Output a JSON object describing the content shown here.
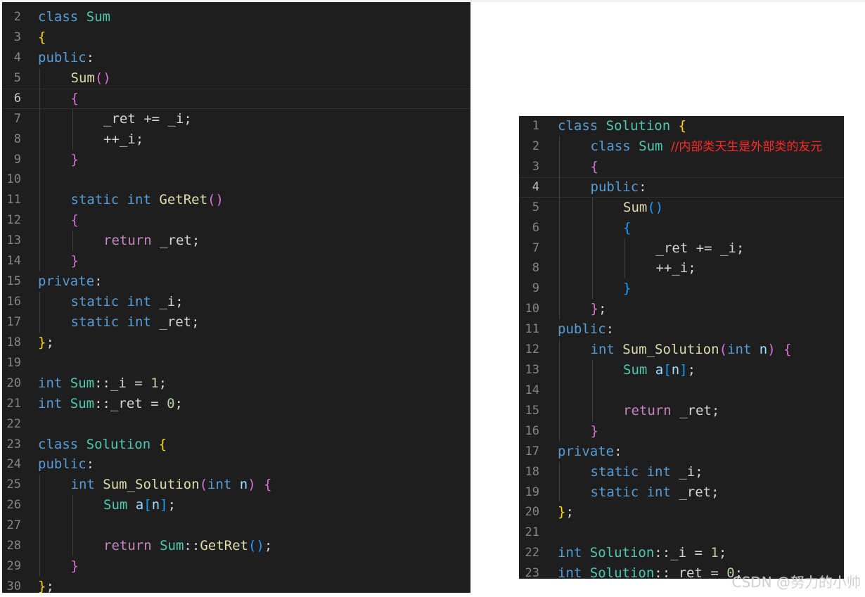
{
  "colors": {
    "editor_bg": "#1e1e1e",
    "keyword": "#569cd6",
    "class_name": "#4ec9b0",
    "function": "#dcdcaa",
    "control": "#c586c0",
    "number": "#b5cea8",
    "bracket_level1": "#ffd700",
    "bracket_level2": "#da70d6",
    "bracket_level3": "#179fff",
    "comment": "#ff2a2a"
  },
  "left_editor": {
    "active_line": "6",
    "lines": [
      {
        "num": "2",
        "indent": 0,
        "tokens": [
          [
            "kw",
            "class"
          ],
          [
            "txt",
            " "
          ],
          [
            "cls",
            "Sum"
          ]
        ]
      },
      {
        "num": "3",
        "indent": 0,
        "tokens": [
          [
            "br1",
            "{"
          ]
        ]
      },
      {
        "num": "4",
        "indent": 0,
        "tokens": [
          [
            "kw",
            "public"
          ],
          [
            "txt",
            ":"
          ]
        ]
      },
      {
        "num": "5",
        "indent": 1,
        "tokens": [
          [
            "fn",
            "Sum"
          ],
          [
            "br2",
            "()"
          ]
        ]
      },
      {
        "num": "6",
        "indent": 1,
        "tokens": [
          [
            "br2",
            "{"
          ]
        ]
      },
      {
        "num": "7",
        "indent": 2,
        "tokens": [
          [
            "txt",
            "_ret += _i;"
          ]
        ]
      },
      {
        "num": "8",
        "indent": 2,
        "tokens": [
          [
            "txt",
            "++_i;"
          ]
        ]
      },
      {
        "num": "9",
        "indent": 1,
        "tokens": [
          [
            "br2",
            "}"
          ]
        ]
      },
      {
        "num": "10",
        "indent": 0,
        "tokens": []
      },
      {
        "num": "11",
        "indent": 1,
        "tokens": [
          [
            "kw",
            "static"
          ],
          [
            "txt",
            " "
          ],
          [
            "kw",
            "int"
          ],
          [
            "txt",
            " "
          ],
          [
            "fn",
            "GetRet"
          ],
          [
            "br2",
            "()"
          ]
        ]
      },
      {
        "num": "12",
        "indent": 1,
        "tokens": [
          [
            "br2",
            "{"
          ]
        ]
      },
      {
        "num": "13",
        "indent": 2,
        "tokens": [
          [
            "ctl",
            "return"
          ],
          [
            "txt",
            " _ret;"
          ]
        ]
      },
      {
        "num": "14",
        "indent": 1,
        "tokens": [
          [
            "br2",
            "}"
          ]
        ]
      },
      {
        "num": "15",
        "indent": 0,
        "tokens": [
          [
            "kw",
            "private"
          ],
          [
            "txt",
            ":"
          ]
        ]
      },
      {
        "num": "16",
        "indent": 1,
        "tokens": [
          [
            "kw",
            "static"
          ],
          [
            "txt",
            " "
          ],
          [
            "kw",
            "int"
          ],
          [
            "txt",
            " _i;"
          ]
        ]
      },
      {
        "num": "17",
        "indent": 1,
        "tokens": [
          [
            "kw",
            "static"
          ],
          [
            "txt",
            " "
          ],
          [
            "kw",
            "int"
          ],
          [
            "txt",
            " _ret;"
          ]
        ]
      },
      {
        "num": "18",
        "indent": 0,
        "tokens": [
          [
            "br1",
            "}"
          ],
          [
            "txt",
            ";"
          ]
        ]
      },
      {
        "num": "19",
        "indent": 0,
        "tokens": []
      },
      {
        "num": "20",
        "indent": 0,
        "tokens": [
          [
            "kw",
            "int"
          ],
          [
            "txt",
            " "
          ],
          [
            "cls",
            "Sum"
          ],
          [
            "txt",
            "::_i = "
          ],
          [
            "num",
            "1"
          ],
          [
            "txt",
            ";"
          ]
        ]
      },
      {
        "num": "21",
        "indent": 0,
        "tokens": [
          [
            "kw",
            "int"
          ],
          [
            "txt",
            " "
          ],
          [
            "cls",
            "Sum"
          ],
          [
            "txt",
            "::_ret = "
          ],
          [
            "num",
            "0"
          ],
          [
            "txt",
            ";"
          ]
        ]
      },
      {
        "num": "22",
        "indent": 0,
        "tokens": []
      },
      {
        "num": "23",
        "indent": 0,
        "tokens": [
          [
            "kw",
            "class"
          ],
          [
            "txt",
            " "
          ],
          [
            "cls",
            "Solution"
          ],
          [
            "txt",
            " "
          ],
          [
            "br1",
            "{"
          ]
        ]
      },
      {
        "num": "24",
        "indent": 0,
        "tokens": [
          [
            "kw",
            "public"
          ],
          [
            "txt",
            ":"
          ]
        ]
      },
      {
        "num": "25",
        "indent": 1,
        "tokens": [
          [
            "kw",
            "int"
          ],
          [
            "txt",
            " "
          ],
          [
            "fn",
            "Sum_Solution"
          ],
          [
            "br2",
            "("
          ],
          [
            "kw",
            "int"
          ],
          [
            "txt",
            " "
          ],
          [
            "var",
            "n"
          ],
          [
            "br2",
            ")"
          ],
          [
            "txt",
            " "
          ],
          [
            "br2",
            "{"
          ]
        ]
      },
      {
        "num": "26",
        "indent": 2,
        "tokens": [
          [
            "cls",
            "Sum"
          ],
          [
            "txt",
            " "
          ],
          [
            "var",
            "a"
          ],
          [
            "br3",
            "["
          ],
          [
            "var",
            "n"
          ],
          [
            "br3",
            "]"
          ],
          [
            "txt",
            ";"
          ]
        ]
      },
      {
        "num": "27",
        "indent": 0,
        "tokens": []
      },
      {
        "num": "28",
        "indent": 2,
        "tokens": [
          [
            "ctl",
            "return"
          ],
          [
            "txt",
            " "
          ],
          [
            "cls",
            "Sum"
          ],
          [
            "txt",
            "::"
          ],
          [
            "fn",
            "GetRet"
          ],
          [
            "br3",
            "()"
          ],
          [
            "txt",
            ";"
          ]
        ]
      },
      {
        "num": "29",
        "indent": 1,
        "tokens": [
          [
            "br2",
            "}"
          ]
        ]
      },
      {
        "num": "30",
        "indent": 0,
        "tokens": [
          [
            "br1",
            "}"
          ],
          [
            "txt",
            ";"
          ]
        ]
      }
    ]
  },
  "right_editor": {
    "active_line": "4",
    "lines": [
      {
        "num": "1",
        "indent": 0,
        "tokens": [
          [
            "kw",
            "class"
          ],
          [
            "txt",
            " "
          ],
          [
            "cls",
            "Solution"
          ],
          [
            "txt",
            " "
          ],
          [
            "br1",
            "{"
          ]
        ]
      },
      {
        "num": "2",
        "indent": 1,
        "tokens": [
          [
            "kw",
            "class"
          ],
          [
            "txt",
            " "
          ],
          [
            "cls",
            "Sum"
          ],
          [
            "txt",
            " "
          ],
          [
            "cmt",
            "//内部类天生是外部类的友元"
          ]
        ]
      },
      {
        "num": "3",
        "indent": 1,
        "tokens": [
          [
            "br2",
            "{"
          ]
        ]
      },
      {
        "num": "4",
        "indent": 1,
        "tokens": [
          [
            "kw",
            "public"
          ],
          [
            "txt",
            ":"
          ]
        ]
      },
      {
        "num": "5",
        "indent": 2,
        "tokens": [
          [
            "fn",
            "Sum"
          ],
          [
            "br3",
            "()"
          ]
        ]
      },
      {
        "num": "6",
        "indent": 2,
        "tokens": [
          [
            "br3",
            "{"
          ]
        ]
      },
      {
        "num": "7",
        "indent": 3,
        "tokens": [
          [
            "txt",
            "_ret += _i;"
          ]
        ]
      },
      {
        "num": "8",
        "indent": 3,
        "tokens": [
          [
            "txt",
            "++_i;"
          ]
        ]
      },
      {
        "num": "9",
        "indent": 2,
        "tokens": [
          [
            "br3",
            "}"
          ]
        ]
      },
      {
        "num": "10",
        "indent": 1,
        "tokens": [
          [
            "br2",
            "}"
          ],
          [
            "txt",
            ";"
          ]
        ]
      },
      {
        "num": "11",
        "indent": 0,
        "tokens": [
          [
            "kw",
            "public"
          ],
          [
            "txt",
            ":"
          ]
        ]
      },
      {
        "num": "12",
        "indent": 1,
        "tokens": [
          [
            "kw",
            "int"
          ],
          [
            "txt",
            " "
          ],
          [
            "fn",
            "Sum_Solution"
          ],
          [
            "br2",
            "("
          ],
          [
            "kw",
            "int"
          ],
          [
            "txt",
            " "
          ],
          [
            "var",
            "n"
          ],
          [
            "br2",
            ")"
          ],
          [
            "txt",
            " "
          ],
          [
            "br2",
            "{"
          ]
        ]
      },
      {
        "num": "13",
        "indent": 2,
        "tokens": [
          [
            "cls",
            "Sum"
          ],
          [
            "txt",
            " "
          ],
          [
            "var",
            "a"
          ],
          [
            "br3",
            "["
          ],
          [
            "var",
            "n"
          ],
          [
            "br3",
            "]"
          ],
          [
            "txt",
            ";"
          ]
        ]
      },
      {
        "num": "14",
        "indent": 0,
        "tokens": []
      },
      {
        "num": "15",
        "indent": 2,
        "tokens": [
          [
            "ctl",
            "return"
          ],
          [
            "txt",
            " _ret;"
          ]
        ]
      },
      {
        "num": "16",
        "indent": 1,
        "tokens": [
          [
            "br2",
            "}"
          ]
        ]
      },
      {
        "num": "17",
        "indent": 0,
        "tokens": [
          [
            "kw",
            "private"
          ],
          [
            "txt",
            ":"
          ]
        ]
      },
      {
        "num": "18",
        "indent": 1,
        "tokens": [
          [
            "kw",
            "static"
          ],
          [
            "txt",
            " "
          ],
          [
            "kw",
            "int"
          ],
          [
            "txt",
            " _i;"
          ]
        ]
      },
      {
        "num": "19",
        "indent": 1,
        "tokens": [
          [
            "kw",
            "static"
          ],
          [
            "txt",
            " "
          ],
          [
            "kw",
            "int"
          ],
          [
            "txt",
            " _ret;"
          ]
        ]
      },
      {
        "num": "20",
        "indent": 0,
        "tokens": [
          [
            "br1",
            "}"
          ],
          [
            "txt",
            ";"
          ]
        ]
      },
      {
        "num": "21",
        "indent": 0,
        "tokens": []
      },
      {
        "num": "22",
        "indent": 0,
        "tokens": [
          [
            "kw",
            "int"
          ],
          [
            "txt",
            " "
          ],
          [
            "cls",
            "Solution"
          ],
          [
            "txt",
            "::_i = "
          ],
          [
            "num",
            "1"
          ],
          [
            "txt",
            ";"
          ]
        ]
      },
      {
        "num": "23",
        "indent": 0,
        "tokens": [
          [
            "kw",
            "int"
          ],
          [
            "txt",
            " "
          ],
          [
            "cls",
            "Solution"
          ],
          [
            "txt",
            "::_ret = "
          ],
          [
            "num",
            "0"
          ],
          [
            "txt",
            ";"
          ]
        ]
      }
    ]
  },
  "watermark": "CSDN @努力的小帅"
}
